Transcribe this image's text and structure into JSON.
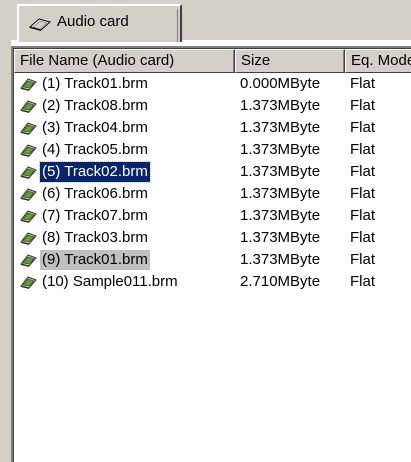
{
  "tab": {
    "label": "Audio card"
  },
  "columns": {
    "name": "File Name (Audio card)",
    "size": "Size",
    "eq": "Eq. Mode"
  },
  "rows": [
    {
      "name": "(1) Track01.brm",
      "size": "0.000MByte",
      "eq": "Flat",
      "state": "normal"
    },
    {
      "name": "(2) Track08.brm",
      "size": "1.373MByte",
      "eq": "Flat",
      "state": "normal"
    },
    {
      "name": "(3) Track04.brm",
      "size": "1.373MByte",
      "eq": "Flat",
      "state": "normal"
    },
    {
      "name": "(4) Track05.brm",
      "size": "1.373MByte",
      "eq": "Flat",
      "state": "normal"
    },
    {
      "name": "(5) Track02.brm",
      "size": "1.373MByte",
      "eq": "Flat",
      "state": "selected"
    },
    {
      "name": "(6) Track06.brm",
      "size": "1.373MByte",
      "eq": "Flat",
      "state": "normal"
    },
    {
      "name": "(7) Track07.brm",
      "size": "1.373MByte",
      "eq": "Flat",
      "state": "normal"
    },
    {
      "name": "(8) Track03.brm",
      "size": "1.373MByte",
      "eq": "Flat",
      "state": "normal"
    },
    {
      "name": "(9) Track01.brm",
      "size": "1.373MByte",
      "eq": "Flat",
      "state": "highlighted"
    },
    {
      "name": "(10) Sample011.brm",
      "size": "2.710MByte",
      "eq": "Flat",
      "state": "normal"
    }
  ],
  "icons": {
    "tab": "audio-card-icon",
    "row": "audio-file-icon"
  },
  "colors": {
    "selection": "#0a246a",
    "highlight": "#c0c0c0",
    "chrome": "#d4d0c8"
  }
}
